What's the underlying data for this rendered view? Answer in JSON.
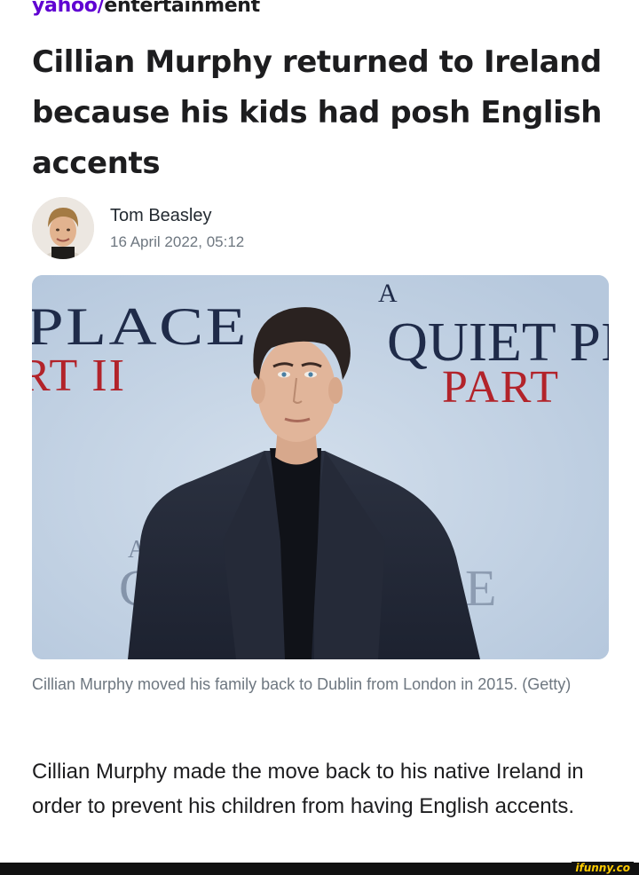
{
  "brand": {
    "yahoo": "yahoo",
    "slash": "/",
    "section": "entertainment",
    "color": "#6001d2"
  },
  "article": {
    "headline": "Cillian Murphy returned to Ireland because his kids had posh English accents",
    "author": "Tom Beasley",
    "date": "16 April 2022, 05:12",
    "photo": {
      "backdrop_left_line1": "PLACE",
      "backdrop_left_line2": "RT II",
      "backdrop_right_top": "A",
      "backdrop_right_line1": "QUIET PI",
      "backdrop_right_line2": "PART",
      "backdrop_bottom_a": "A",
      "backdrop_bottom_c": "C",
      "backdrop_bottom_e": "E"
    },
    "caption": "Cillian Murphy moved his family back to Dublin from London in 2015. (Getty)",
    "body": "Cillian Murphy made the move back to his native Ireland in order to prevent his children from having English accents."
  },
  "watermark": "ifunny.co",
  "colors": {
    "backdrop_blue": "#c4d4e6",
    "backdrop_text": "#1f2b49",
    "backdrop_red": "#b2232a"
  }
}
